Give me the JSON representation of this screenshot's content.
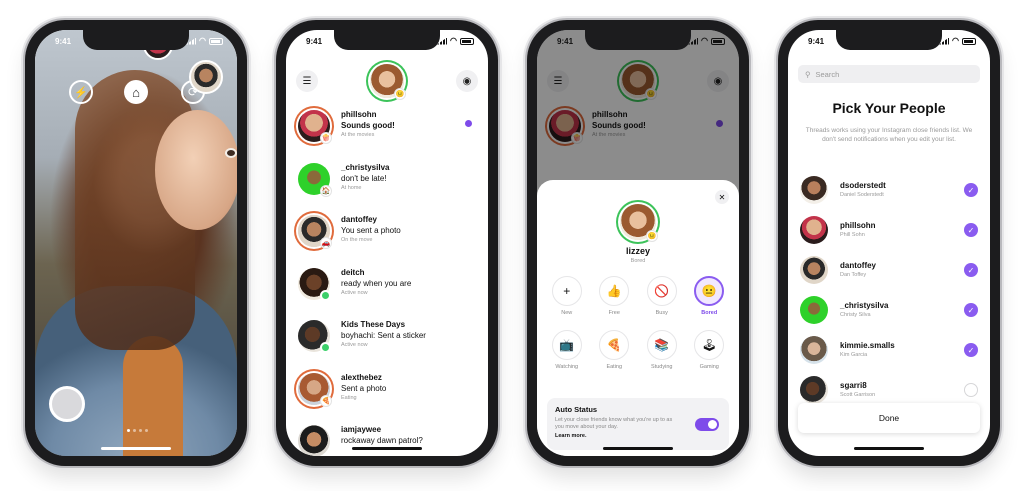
{
  "status_time": "9:41",
  "camera": {
    "flash_icon": "flash-off-icon",
    "home_icon": "home-icon",
    "flip_icon": "flip-camera-icon",
    "avatars": [
      "dsoderstedt",
      "phillsohn",
      "dantoffey"
    ]
  },
  "threads": [
    {
      "name": "phillsohn",
      "message": "Sounds good!",
      "status": "At the movies",
      "unread": true
    },
    {
      "name": "_christysilva",
      "message": "don't be late!",
      "status": "At home",
      "unread": false
    },
    {
      "name": "dantoffey",
      "message": "You sent a photo",
      "status": "On the move",
      "unread": false
    },
    {
      "name": "deitch",
      "message": "ready when you are",
      "status": "Active now",
      "unread": false
    },
    {
      "name": "Kids These Days",
      "message": "boyhachi: Sent a sticker",
      "status": "Active now",
      "unread": false
    },
    {
      "name": "alexthebez",
      "message": "Sent a photo",
      "status": "Eating",
      "unread": false
    },
    {
      "name": "iamjaywee",
      "message": "rockaway dawn patrol?",
      "status": "",
      "unread": false
    }
  ],
  "status_sheet": {
    "user_name": "lizzey",
    "user_status": "Bored",
    "options": [
      {
        "label": "New",
        "icon": "+",
        "selected": false
      },
      {
        "label": "Free",
        "icon": "👍",
        "selected": false
      },
      {
        "label": "Busy",
        "icon": "🚫",
        "selected": false
      },
      {
        "label": "Bored",
        "icon": "😐",
        "selected": true
      },
      {
        "label": "Watching",
        "icon": "📺",
        "selected": false
      },
      {
        "label": "Eating",
        "icon": "🍕",
        "selected": false
      },
      {
        "label": "Studying",
        "icon": "📚",
        "selected": false
      },
      {
        "label": "Gaming",
        "icon": "🕹",
        "selected": false
      }
    ],
    "auto_status": {
      "title": "Auto Status",
      "description": "Let your close friends know what you're up to as you move about your day.",
      "learn_more": "Learn more.",
      "enabled": true
    }
  },
  "pick_people": {
    "search_placeholder": "Search",
    "title": "Pick Your People",
    "description": "Threads works using your Instagram close friends list. We don't send notifications when you edit your list.",
    "people": [
      {
        "username": "dsoderstedt",
        "full_name": "Daniel Soderstedt",
        "selected": true
      },
      {
        "username": "phillsohn",
        "full_name": "Phill Sohn",
        "selected": true
      },
      {
        "username": "dantoffey",
        "full_name": "Dan Toffey",
        "selected": true
      },
      {
        "username": "_christysilva",
        "full_name": "Christy Silva",
        "selected": true
      },
      {
        "username": "kimmie.smalls",
        "full_name": "Kim Garcia",
        "selected": true
      },
      {
        "username": "sgarri8",
        "full_name": "Scott Garrison",
        "selected": false
      }
    ],
    "done_label": "Done"
  },
  "colors": {
    "accent": "#7e4bea",
    "active_green": "#3cd06a"
  }
}
